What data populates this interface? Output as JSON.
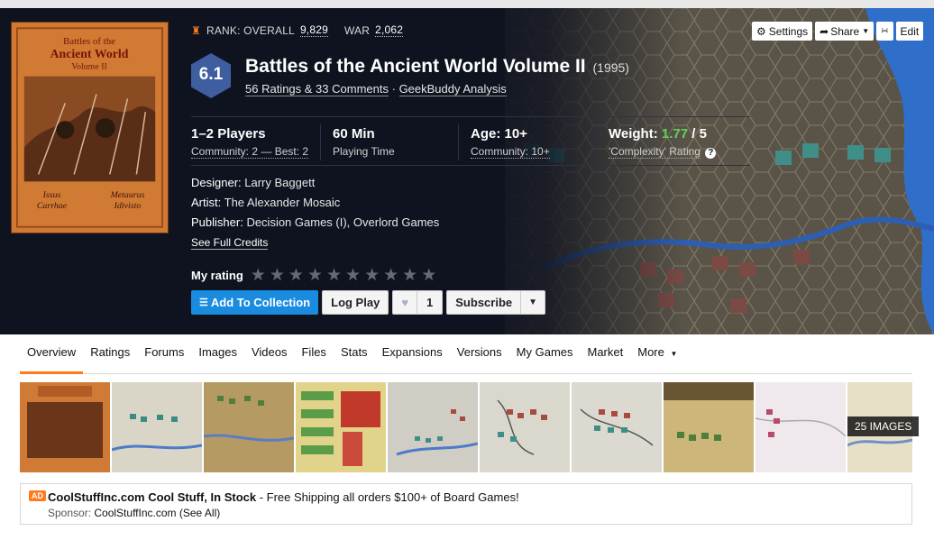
{
  "rank": {
    "overall_label": "RANK: OVERALL",
    "overall_value": "9,829",
    "war_label": "WAR",
    "war_value": "2,062"
  },
  "game": {
    "rating": "6.1",
    "title": "Battles of the Ancient World Volume II",
    "year": "(1995)",
    "ratings_link": "56 Ratings & 33 Comments",
    "separator": "·",
    "analysis_link": "GeekBuddy Analysis"
  },
  "box_art": {
    "line1": "Battles of the",
    "line2": "Ancient World",
    "line3": "Volume II",
    "bl1": "Issus",
    "bl2": "Carrhae",
    "br1": "Metaurus",
    "br2": "Idivisto"
  },
  "stats": {
    "players": "1–2 Players",
    "players_sub": "Community: 2 — Best: 2",
    "time": "60 Min",
    "time_sub": "Playing Time",
    "age": "Age: 10+",
    "age_sub": "Community: 10+",
    "weight_label": "Weight:",
    "weight_value": "1.77",
    "weight_max": "/ 5",
    "weight_sub": "'Complexity' Rating"
  },
  "credits": {
    "designer_label": "Designer:",
    "designer": "Larry Baggett",
    "artist_label": "Artist:",
    "artist": "The Alexander Mosaic",
    "publisher_label": "Publisher:",
    "publisher": "Decision Games (I), Overlord Games",
    "see_full": "See Full Credits"
  },
  "my_rating": {
    "label": "My rating",
    "stars": 10
  },
  "actions": {
    "add_collection": "Add To Collection",
    "log_play": "Log Play",
    "like_count": "1",
    "subscribe": "Subscribe"
  },
  "top_buttons": {
    "settings": "Settings",
    "share": "Share",
    "edit": "Edit"
  },
  "nav": {
    "items": [
      "Overview",
      "Ratings",
      "Forums",
      "Images",
      "Videos",
      "Files",
      "Stats",
      "Expansions",
      "Versions",
      "My Games",
      "Market",
      "More"
    ],
    "active": "Overview"
  },
  "gallery": {
    "count_label": "25 IMAGES"
  },
  "ad": {
    "badge": "AD",
    "title": "CoolStuffInc.com Cool Stuff, In Stock",
    "text": " - Free Shipping all orders $100+ of Board Games!",
    "sponsor_label": "Sponsor:",
    "sponsor": "CoolStuffInc.com",
    "see_all": "(See All)"
  },
  "colors": {
    "hero_bg": "#0f1320",
    "accent_orange": "#ff7a1a",
    "primary_blue": "#1a8ce0",
    "weight_green": "#5fd35a",
    "hex_blue": "#3f5ea0"
  }
}
